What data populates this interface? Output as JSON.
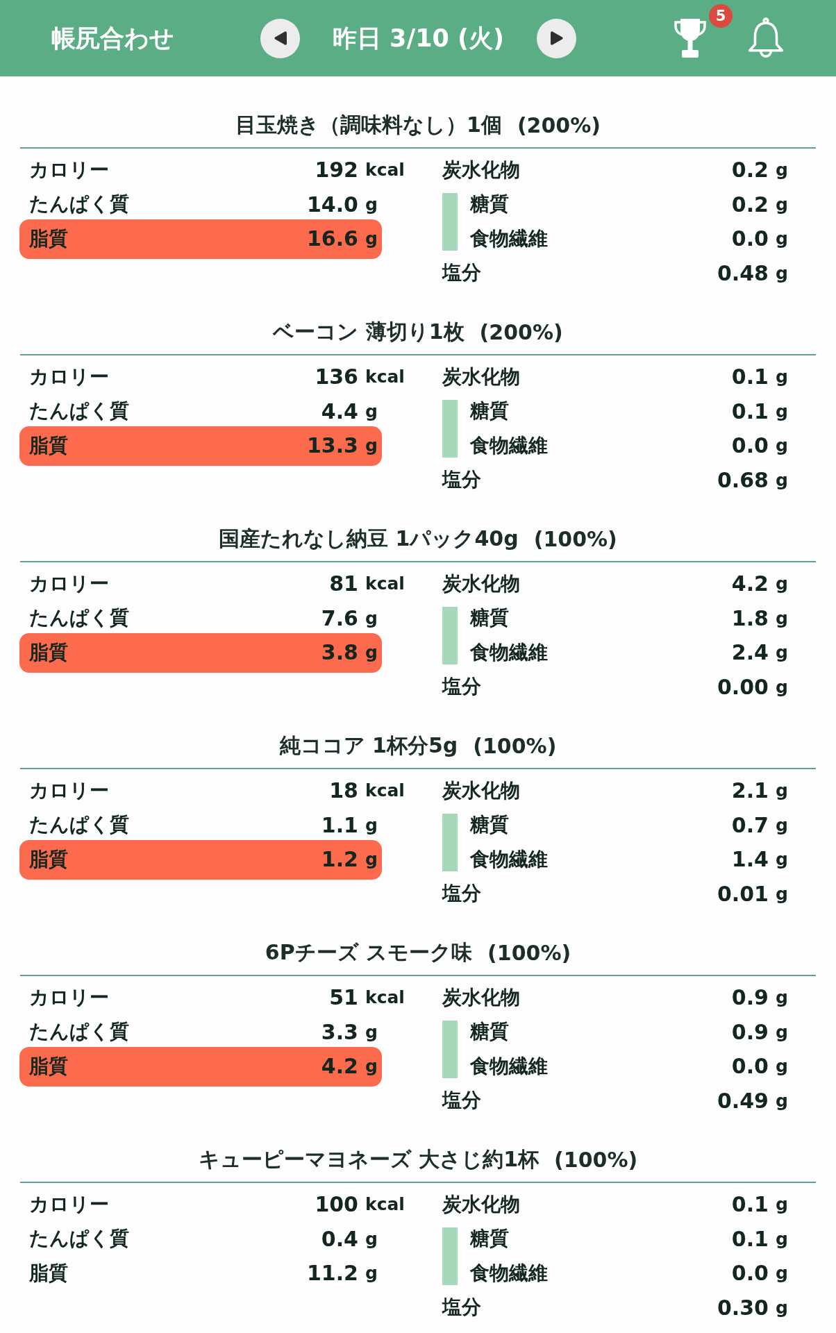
{
  "header": {
    "title": "帳尻合わせ",
    "date": "昨日 3/10 (火)",
    "trophy_badge": "5"
  },
  "foods": [
    {
      "name": "目玉焼き（調味料なし）1個",
      "ratio": "(200%)",
      "left": [
        {
          "label": "カロリー",
          "value": "192",
          "unit": "kcal",
          "highlighted": false
        },
        {
          "label": "たんぱく質",
          "value": "14.0",
          "unit": "g",
          "highlighted": false
        },
        {
          "label": "脂質",
          "value": "16.6",
          "unit": "g",
          "highlighted": true
        }
      ],
      "right": [
        {
          "label": "炭水化物",
          "value": "0.2",
          "unit": "g",
          "breakdown": [
            {
              "label": "糖質",
              "value": "0.2",
              "unit": "g"
            },
            {
              "label": "食物繊維",
              "value": "0.0",
              "unit": "g"
            }
          ]
        },
        {
          "label": "塩分",
          "value": "0.48",
          "unit": "g"
        }
      ]
    },
    {
      "name": "ベーコン 薄切り1枚",
      "ratio": "(200%)",
      "left": [
        {
          "label": "カロリー",
          "value": "136",
          "unit": "kcal",
          "highlighted": false
        },
        {
          "label": "たんぱく質",
          "value": "4.4",
          "unit": "g",
          "highlighted": false
        },
        {
          "label": "脂質",
          "value": "13.3",
          "unit": "g",
          "highlighted": true
        }
      ],
      "right": [
        {
          "label": "炭水化物",
          "value": "0.1",
          "unit": "g",
          "breakdown": [
            {
              "label": "糖質",
              "value": "0.1",
              "unit": "g"
            },
            {
              "label": "食物繊維",
              "value": "0.0",
              "unit": "g"
            }
          ]
        },
        {
          "label": "塩分",
          "value": "0.68",
          "unit": "g"
        }
      ]
    },
    {
      "name": "国産たれなし納豆 1パック40g",
      "ratio": "(100%)",
      "left": [
        {
          "label": "カロリー",
          "value": "81",
          "unit": "kcal",
          "highlighted": false
        },
        {
          "label": "たんぱく質",
          "value": "7.6",
          "unit": "g",
          "highlighted": false
        },
        {
          "label": "脂質",
          "value": "3.8",
          "unit": "g",
          "highlighted": true
        }
      ],
      "right": [
        {
          "label": "炭水化物",
          "value": "4.2",
          "unit": "g",
          "breakdown": [
            {
              "label": "糖質",
              "value": "1.8",
              "unit": "g"
            },
            {
              "label": "食物繊維",
              "value": "2.4",
              "unit": "g"
            }
          ]
        },
        {
          "label": "塩分",
          "value": "0.00",
          "unit": "g"
        }
      ]
    },
    {
      "name": "純ココア 1杯分5g",
      "ratio": "(100%)",
      "left": [
        {
          "label": "カロリー",
          "value": "18",
          "unit": "kcal",
          "highlighted": false
        },
        {
          "label": "たんぱく質",
          "value": "1.1",
          "unit": "g",
          "highlighted": false
        },
        {
          "label": "脂質",
          "value": "1.2",
          "unit": "g",
          "highlighted": true
        }
      ],
      "right": [
        {
          "label": "炭水化物",
          "value": "2.1",
          "unit": "g",
          "breakdown": [
            {
              "label": "糖質",
              "value": "0.7",
              "unit": "g"
            },
            {
              "label": "食物繊維",
              "value": "1.4",
              "unit": "g"
            }
          ]
        },
        {
          "label": "塩分",
          "value": "0.01",
          "unit": "g"
        }
      ]
    },
    {
      "name": "6Pチーズ スモーク味",
      "ratio": "(100%)",
      "left": [
        {
          "label": "カロリー",
          "value": "51",
          "unit": "kcal",
          "highlighted": false
        },
        {
          "label": "たんぱく質",
          "value": "3.3",
          "unit": "g",
          "highlighted": false
        },
        {
          "label": "脂質",
          "value": "4.2",
          "unit": "g",
          "highlighted": true
        }
      ],
      "right": [
        {
          "label": "炭水化物",
          "value": "0.9",
          "unit": "g",
          "breakdown": [
            {
              "label": "糖質",
              "value": "0.9",
              "unit": "g"
            },
            {
              "label": "食物繊維",
              "value": "0.0",
              "unit": "g"
            }
          ]
        },
        {
          "label": "塩分",
          "value": "0.49",
          "unit": "g"
        }
      ]
    },
    {
      "name": "キューピーマヨネーズ 大さじ約1杯",
      "ratio": "(100%)",
      "left": [
        {
          "label": "カロリー",
          "value": "100",
          "unit": "kcal",
          "highlighted": false
        },
        {
          "label": "たんぱく質",
          "value": "0.4",
          "unit": "g",
          "highlighted": false
        },
        {
          "label": "脂質",
          "value": "11.2",
          "unit": "g",
          "highlighted": false
        }
      ],
      "right": [
        {
          "label": "炭水化物",
          "value": "0.1",
          "unit": "g",
          "breakdown": [
            {
              "label": "糖質",
              "value": "0.1",
              "unit": "g"
            },
            {
              "label": "食物繊維",
              "value": "0.0",
              "unit": "g"
            }
          ]
        },
        {
          "label": "塩分",
          "value": "0.30",
          "unit": "g"
        }
      ]
    }
  ]
}
